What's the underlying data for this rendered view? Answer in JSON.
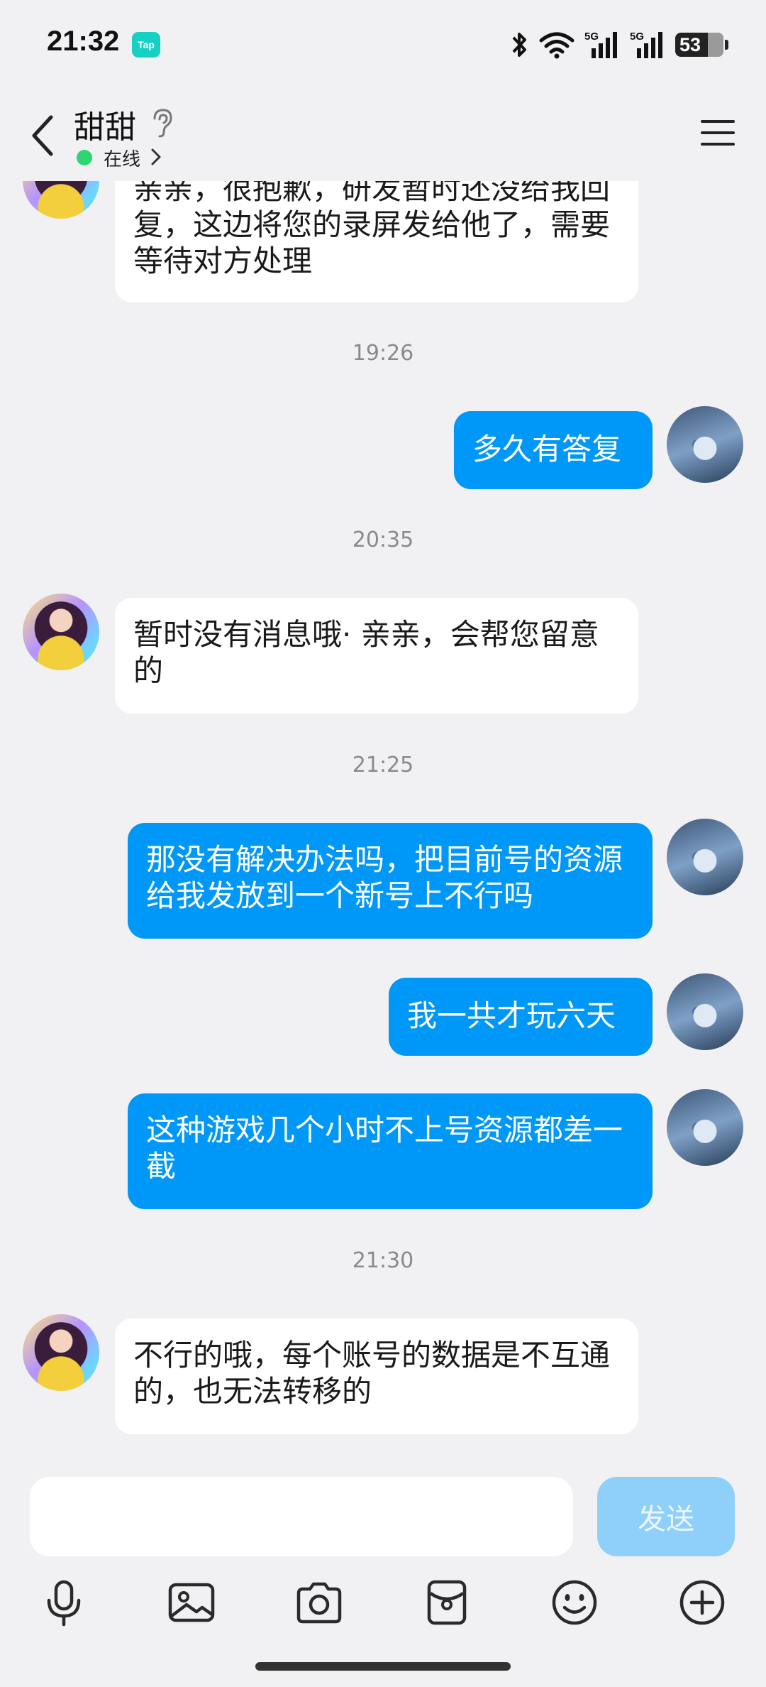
{
  "status_bar": {
    "time": "21:32",
    "app_badge": "Tap",
    "battery": "53"
  },
  "header": {
    "contact_name": "甜甜",
    "status": "在线"
  },
  "messages": [
    {
      "type": "in",
      "text": "亲亲，很抱歉，研发暂时还没给我回复，这边将您的录屏发给他了，需要等待对方处理"
    },
    {
      "type": "time",
      "text": "19:26"
    },
    {
      "type": "out",
      "text": "多久有答复"
    },
    {
      "type": "time",
      "text": "20:35"
    },
    {
      "type": "in",
      "text": "暂时没有消息哦· 亲亲，会帮您留意的"
    },
    {
      "type": "time",
      "text": "21:25"
    },
    {
      "type": "out",
      "text": "那没有解决办法吗，把目前号的资源给我发放到一个新号上不行吗"
    },
    {
      "type": "out",
      "text": "我一共才玩六天"
    },
    {
      "type": "out",
      "text": "这种游戏几个小时不上号资源都差一截"
    },
    {
      "type": "time",
      "text": "21:30"
    },
    {
      "type": "in",
      "text": "不行的哦，每个账号的数据是不互通的，也无法转移的"
    }
  ],
  "composer": {
    "input_value": "",
    "send_label": "发送"
  },
  "toolbar": [
    "microphone-icon",
    "image-icon",
    "camera-icon",
    "red-packet-icon",
    "emoji-icon",
    "plus-icon"
  ],
  "colors": {
    "outgoing_bubble": "#0098f8",
    "incoming_bubble": "#ffffff",
    "background": "#f1f1f3",
    "send_button": "#8fd0fb",
    "online": "#2ed573"
  }
}
